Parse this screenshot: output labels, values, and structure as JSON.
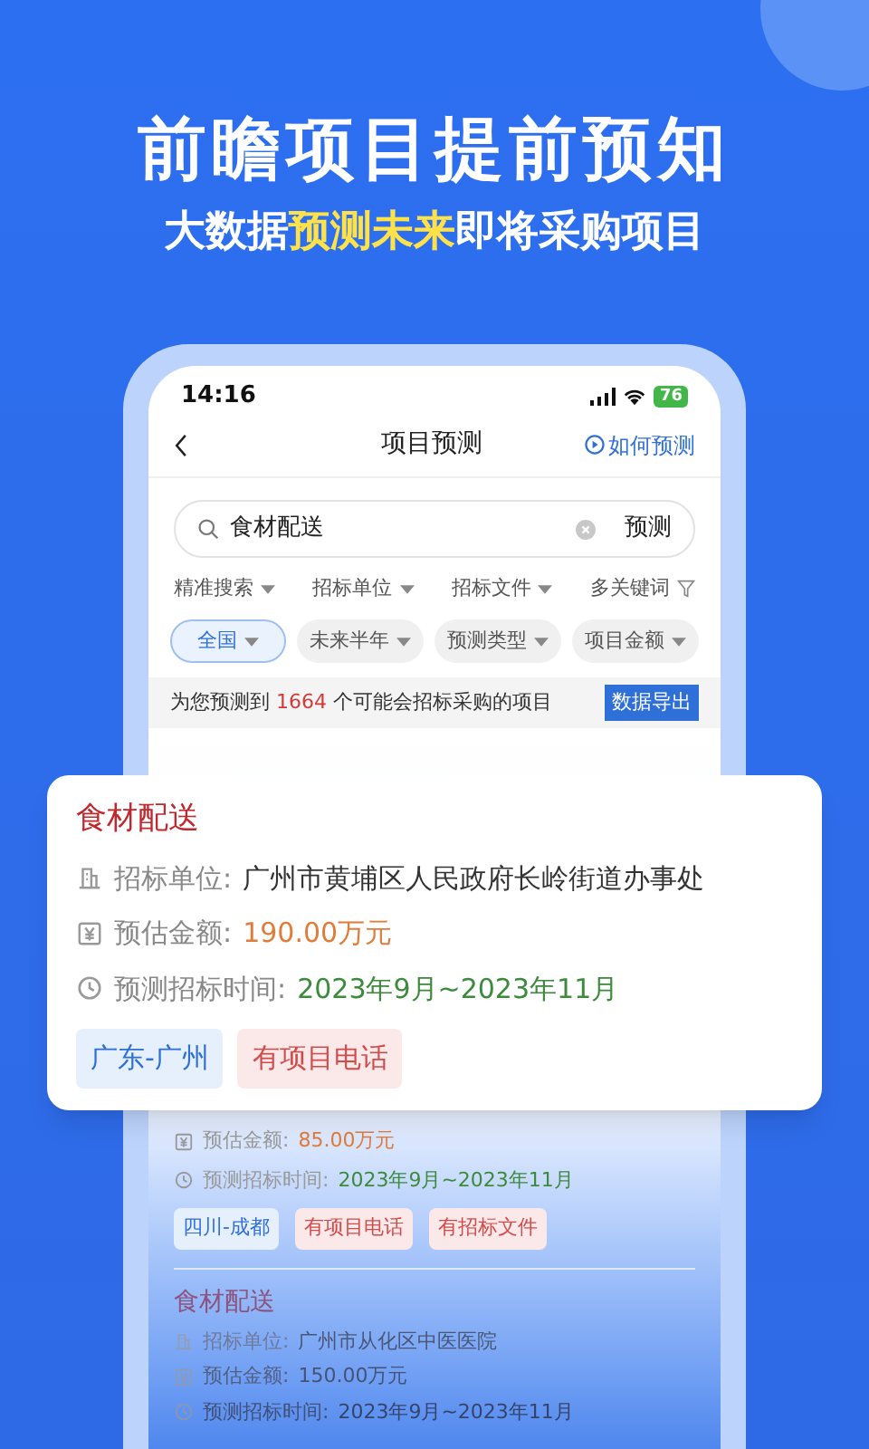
{
  "headline": "前瞻项目提前预知",
  "subheadline": [
    {
      "text": "大数据",
      "highlight": false
    },
    {
      "text": "预测未来",
      "highlight": true
    },
    {
      "text": "即将采购项目",
      "highlight": false
    }
  ],
  "phone": {
    "status_bar": {
      "time": "14:16",
      "battery": "76"
    },
    "nav": {
      "title": "项目预测",
      "help": "如何预测"
    },
    "search": {
      "value": "食材配送",
      "button": "预测"
    },
    "filters": [
      "精准搜索",
      "招标单位",
      "招标文件",
      "多关键词"
    ],
    "chips": [
      {
        "label": "全国",
        "selected": true
      },
      {
        "label": "未来半年",
        "selected": false
      },
      {
        "label": "预测类型",
        "selected": false
      },
      {
        "label": "项目金额",
        "selected": false
      }
    ],
    "result_bar": {
      "prefix": "为您预测到",
      "count": "1664",
      "suffix": "个可能会招标采购的项目",
      "export": "数据导出"
    },
    "list": [
      {
        "amount_label": "预估金额:",
        "amount": "85.00万元",
        "time_label": "预测招标时间:",
        "time": "2023年9月~2023年11月",
        "tags": [
          {
            "label": "四川-成都",
            "kind": "region"
          },
          {
            "label": "有项目电话",
            "kind": "feature"
          },
          {
            "label": "有招标文件",
            "kind": "feature"
          }
        ]
      },
      {
        "title": "食材配送",
        "unit_label": "招标单位:",
        "unit": "广州市从化区中医医院",
        "amount_label": "预估金额:",
        "amount": "150.00万元",
        "time_label": "预测招标时间:",
        "time": "2023年9月~2023年11月"
      }
    ]
  },
  "featured": {
    "title": "食材配送",
    "unit_label": "招标单位:",
    "unit": "广州市黄埔区人民政府长岭街道办事处",
    "amount_label": "预估金额:",
    "amount": "190.00万元",
    "time_label": "预测招标时间:",
    "time": "2023年9月~2023年11月",
    "tags": [
      {
        "label": "广东-广州",
        "kind": "region"
      },
      {
        "label": "有项目电话",
        "kind": "feature"
      }
    ]
  }
}
